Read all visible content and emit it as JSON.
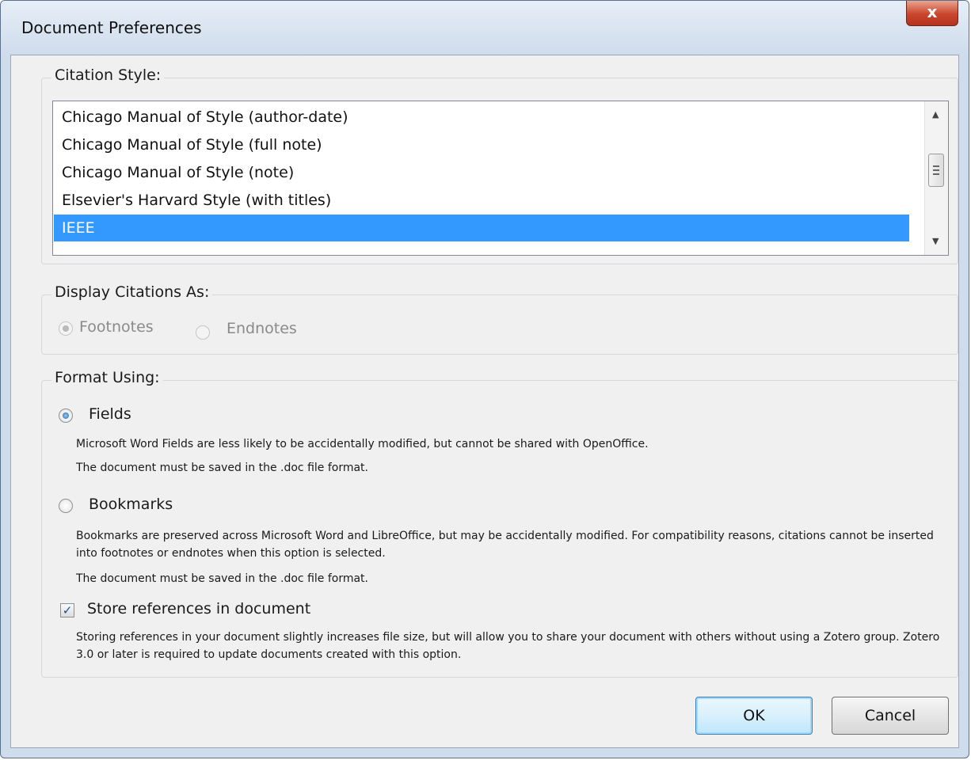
{
  "window": {
    "title": "Document Preferences",
    "close_label": "x"
  },
  "citation_style": {
    "label": "Citation Style:",
    "items": [
      "Chicago Manual of Style (author-date)",
      "Chicago Manual of Style (full note)",
      "Chicago Manual of Style (note)",
      "Elsevier's Harvard Style (with titles)",
      "IEEE"
    ],
    "selected": "IEEE"
  },
  "display_citations": {
    "label": "Display Citations As:",
    "footnotes": "Footnotes",
    "endnotes": "Endnotes",
    "selected": "Footnotes",
    "enabled": false
  },
  "format_using": {
    "label": "Format Using:",
    "fields": {
      "label": "Fields",
      "desc1": "Microsoft Word Fields are less likely to be accidentally modified, but cannot be shared with OpenOffice.",
      "desc2": "The document must be saved in the .doc file format."
    },
    "bookmarks": {
      "label": "Bookmarks",
      "desc1": "Bookmarks are preserved across Microsoft Word and LibreOffice, but may be accidentally modified. For compatibility reasons, citations cannot be inserted into footnotes or endnotes when this option is selected.",
      "desc2": "The document must be saved in the .doc file format."
    },
    "selected": "Fields",
    "store_refs": {
      "label": "Store references in document",
      "checked": true,
      "desc": "Storing references in your document slightly increases file size, but will allow you to share your document with others without using a Zotero group. Zotero 3.0 or later is required to update documents created with this option."
    }
  },
  "buttons": {
    "ok": "OK",
    "cancel": "Cancel"
  },
  "colors": {
    "selection": "#3399ff",
    "window_frame": "#cfdceb"
  }
}
